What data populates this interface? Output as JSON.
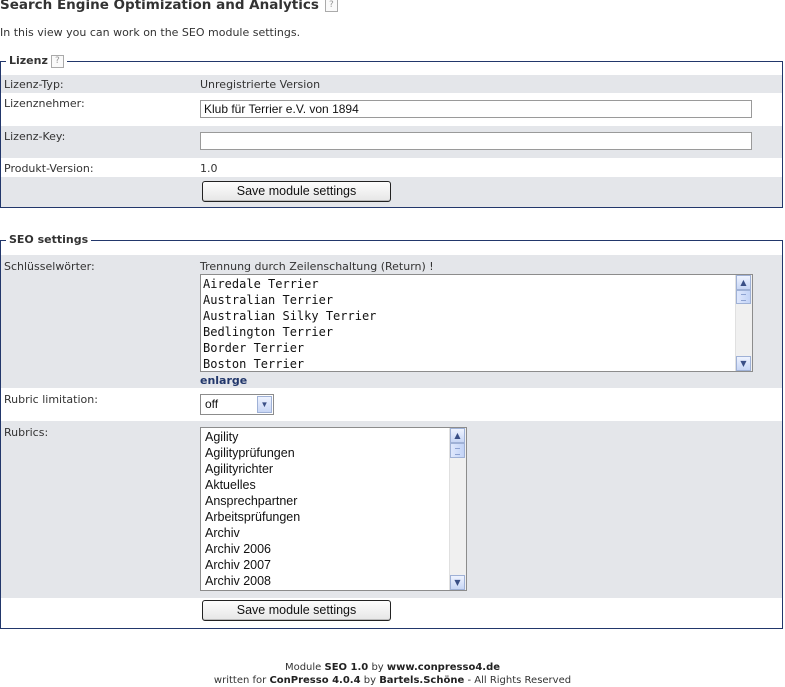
{
  "page": {
    "title": "Search Engine Optimization and Analytics",
    "intro": "In this view you can work on the SEO module settings."
  },
  "lizenz": {
    "legend": "Lizenz",
    "typ_label": "Lizenz-Typ:",
    "typ_value": "Unregistrierte Version",
    "nehmer_label": "Lizenznehmer:",
    "nehmer_value": "Klub für Terrier e.V. von 1894",
    "key_label": "Lizenz-Key:",
    "key_value": "",
    "version_label": "Produkt-Version:",
    "version_value": "1.0",
    "save_label": "Save module settings"
  },
  "seo": {
    "legend": "SEO settings",
    "keywords_label": "Schlüsselwörter:",
    "keywords_hint": "Trennung durch Zeilenschaltung (Return) !",
    "keywords": [
      "Airedale Terrier",
      "Australian Terrier",
      "Australian Silky Terrier",
      "Bedlington Terrier",
      "Border Terrier",
      "Boston Terrier"
    ],
    "enlarge_label": "enlarge",
    "rubric_limitation_label": "Rubric limitation:",
    "rubric_limitation_value": "off",
    "rubrics_label": "Rubrics:",
    "rubrics": [
      "Agility",
      "Agilityprüfungen",
      "Agilityrichter",
      "Aktuelles",
      "Ansprechpartner",
      "Arbeitsprüfungen",
      "Archiv",
      "Archiv 2006",
      "Archiv 2007",
      "Archiv 2008"
    ],
    "save_label": "Save module settings"
  },
  "footer": {
    "module_prefix": "Module",
    "module_name": "SEO 1.0",
    "by1": "by",
    "site": "www.conpresso4.de",
    "written_for": "written for",
    "product": "ConPresso 4.0.4",
    "by2": "by",
    "author": "Bartels.Schöne",
    "rights": "- All Rights Reserved"
  },
  "icons": {
    "help": "help-icon",
    "scroll_up": "scroll-up-arrow-icon",
    "scroll_down": "scroll-down-arrow-icon",
    "dropdown": "chevron-down-icon"
  },
  "colors": {
    "border": "#22376b",
    "row_grey": "#e4e6ea",
    "link": "#22376b"
  }
}
